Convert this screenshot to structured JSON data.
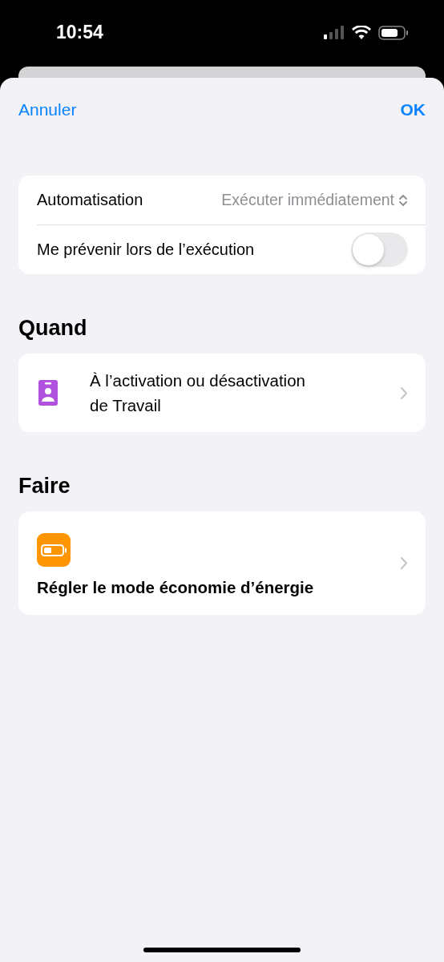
{
  "status_bar": {
    "time": "10:54"
  },
  "nav": {
    "cancel": "Annuler",
    "confirm": "OK"
  },
  "settings": [
    {
      "kind": "picker",
      "label": "Automatisation",
      "value": "Exécuter immédiatement"
    },
    {
      "kind": "toggle",
      "label": "Me prévenir lors de l’exécution",
      "on": false
    }
  ],
  "sections": [
    {
      "title": "Quand",
      "item": {
        "kind": "trigger",
        "text": "À l’activation ou désactivation de Travail"
      }
    },
    {
      "title": "Faire",
      "item": {
        "kind": "action",
        "text": "Régler le mode économie d’énergie"
      }
    }
  ]
}
